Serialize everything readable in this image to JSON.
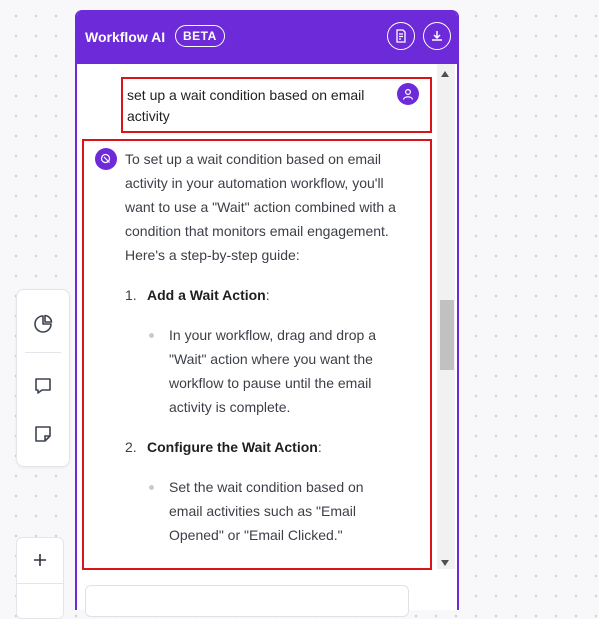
{
  "panel": {
    "title": "Workflow AI",
    "badge": "BETA",
    "accent_color": "#6d2ad8",
    "header_icons": [
      "document-icon",
      "download-icon"
    ]
  },
  "sidebar": {
    "tools": [
      {
        "name": "pie-chart-icon"
      },
      {
        "name": "comment-icon"
      },
      {
        "name": "sticky-note-icon"
      }
    ],
    "zoom": {
      "plus_icon": "plus-icon"
    }
  },
  "conversation": {
    "user_message": "set up a wait condition based on email activity",
    "ai_intro": "To set up a wait condition based on email activity in your automation workflow, you'll want to use a \"Wait\" action combined with a condition that monitors email engagement. Here's a step-by-step guide:",
    "steps": [
      {
        "number": "1.",
        "title": "Add a Wait Action",
        "suffix": ":",
        "bullet": "In your workflow, drag and drop a \"Wait\" action where you want the workflow to pause until the email activity is complete."
      },
      {
        "number": "2.",
        "title": "Configure the Wait Action",
        "suffix": ":",
        "bullet": "Set the wait condition based on email activities such as \"Email Opened\" or \"Email Clicked.\""
      }
    ]
  }
}
